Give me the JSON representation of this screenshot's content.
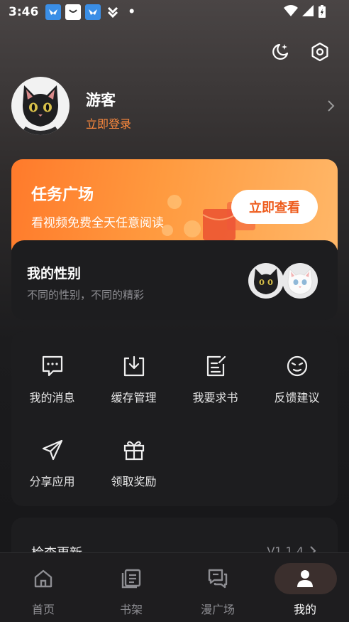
{
  "status_bar": {
    "time": "3:46"
  },
  "header": {
    "theme_icon": "moon-icon",
    "settings_icon": "settings-hex-icon"
  },
  "profile": {
    "name": "游客",
    "login_label": "立即登录"
  },
  "task_card": {
    "title": "任务广场",
    "subtitle": "看视频免费全天任意阅读",
    "button_label": "立即查看"
  },
  "gender_card": {
    "title": "我的性别",
    "subtitle": "不同的性别，不同的精彩"
  },
  "grid": {
    "items": [
      {
        "label": "我的消息",
        "icon": "message-icon"
      },
      {
        "label": "缓存管理",
        "icon": "download-box-icon"
      },
      {
        "label": "我要求书",
        "icon": "edit-document-icon"
      },
      {
        "label": "反馈建议",
        "icon": "feedback-face-icon"
      },
      {
        "label": "分享应用",
        "icon": "send-icon"
      },
      {
        "label": "领取奖励",
        "icon": "gift-icon"
      }
    ]
  },
  "update": {
    "label": "检查更新",
    "version": "V1.1.4"
  },
  "tabbar": {
    "tabs": [
      {
        "label": "首页",
        "icon": "home-icon"
      },
      {
        "label": "书架",
        "icon": "bookshelf-icon"
      },
      {
        "label": "漫广场",
        "icon": "chat-square-icon"
      },
      {
        "label": "我的",
        "icon": "person-icon",
        "active": true
      }
    ]
  },
  "colors": {
    "accent": "#ff8a3d",
    "task_gradient_start": "#ff7a2b",
    "task_gradient_end": "#ffb768",
    "card_bg": "#1d1d1f"
  }
}
